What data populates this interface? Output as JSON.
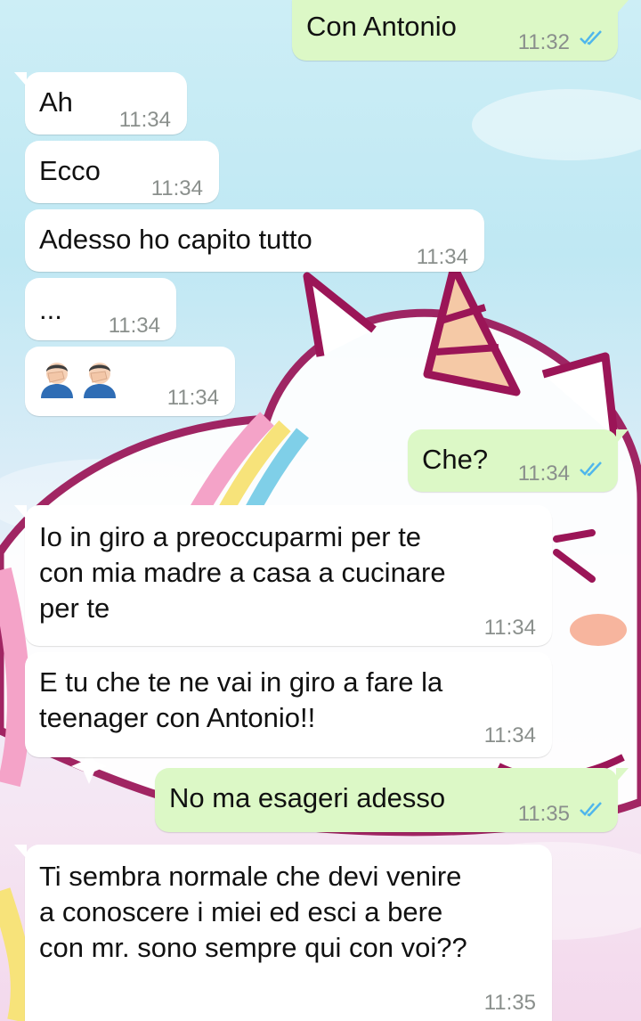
{
  "colors": {
    "incoming_bubble": "#ffffff",
    "outgoing_bubble": "#dcf8c6",
    "read_ticks": "#4fb6ec",
    "time_text": "#8a8f8c"
  },
  "wallpaper": "unicorn-wallpaper",
  "messages": [
    {
      "side": "out",
      "text": "Con Antonio",
      "time": "11:32",
      "status": "read"
    },
    {
      "side": "in",
      "text": "Ah",
      "time": "11:34"
    },
    {
      "side": "in",
      "text": "Ecco",
      "time": "11:34"
    },
    {
      "side": "in",
      "text": "Adesso ho capito tutto",
      "time": "11:34"
    },
    {
      "side": "in",
      "text": "...",
      "time": "11:34"
    },
    {
      "side": "in",
      "text": "",
      "emoji": [
        "man-facepalming-emoji",
        "man-facepalming-emoji"
      ],
      "time": "11:34"
    },
    {
      "side": "out",
      "text": "Che?",
      "time": "11:34",
      "status": "read"
    },
    {
      "side": "in",
      "text": "Io in giro a preoccuparmi per te\ncon mia madre a casa a cucinare\nper te",
      "time": "11:34"
    },
    {
      "side": "in",
      "text": "E tu che te ne vai in giro a fare la\nteenager con Antonio!!",
      "time": "11:34"
    },
    {
      "side": "out",
      "text": "No ma esageri adesso",
      "time": "11:35",
      "status": "read"
    },
    {
      "side": "in",
      "text": "Ti sembra normale che devi venire\na conoscere i miei ed esci a bere\ncon mr. sono sempre qui con voi??",
      "time": "11:35"
    }
  ]
}
